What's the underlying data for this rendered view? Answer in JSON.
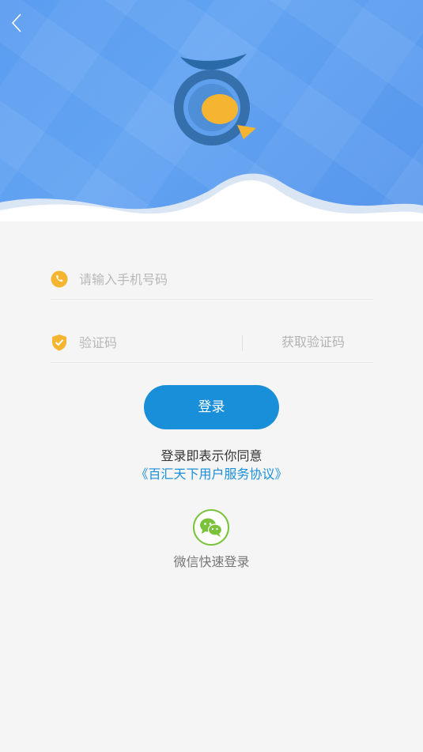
{
  "header": {
    "back_icon": "chevron-left-icon",
    "logo_icon": "app-logo"
  },
  "form": {
    "phone": {
      "value": "",
      "placeholder": "请输入手机号码",
      "icon": "phone-icon"
    },
    "code": {
      "value": "",
      "placeholder": "验证码",
      "icon": "shield-check-icon",
      "get_code_label": "获取验证码"
    }
  },
  "actions": {
    "login_label": "登录"
  },
  "agreement": {
    "text": "登录即表示你同意",
    "link": "《百汇天下用户服务协议》"
  },
  "social": {
    "wechat_icon": "wechat-icon",
    "wechat_label": "微信快速登录"
  },
  "colors": {
    "hero_blue": "#5a9cf0",
    "accent_orange": "#f5b530",
    "primary_blue": "#1a8fd9",
    "wechat_green": "#79c23a"
  }
}
